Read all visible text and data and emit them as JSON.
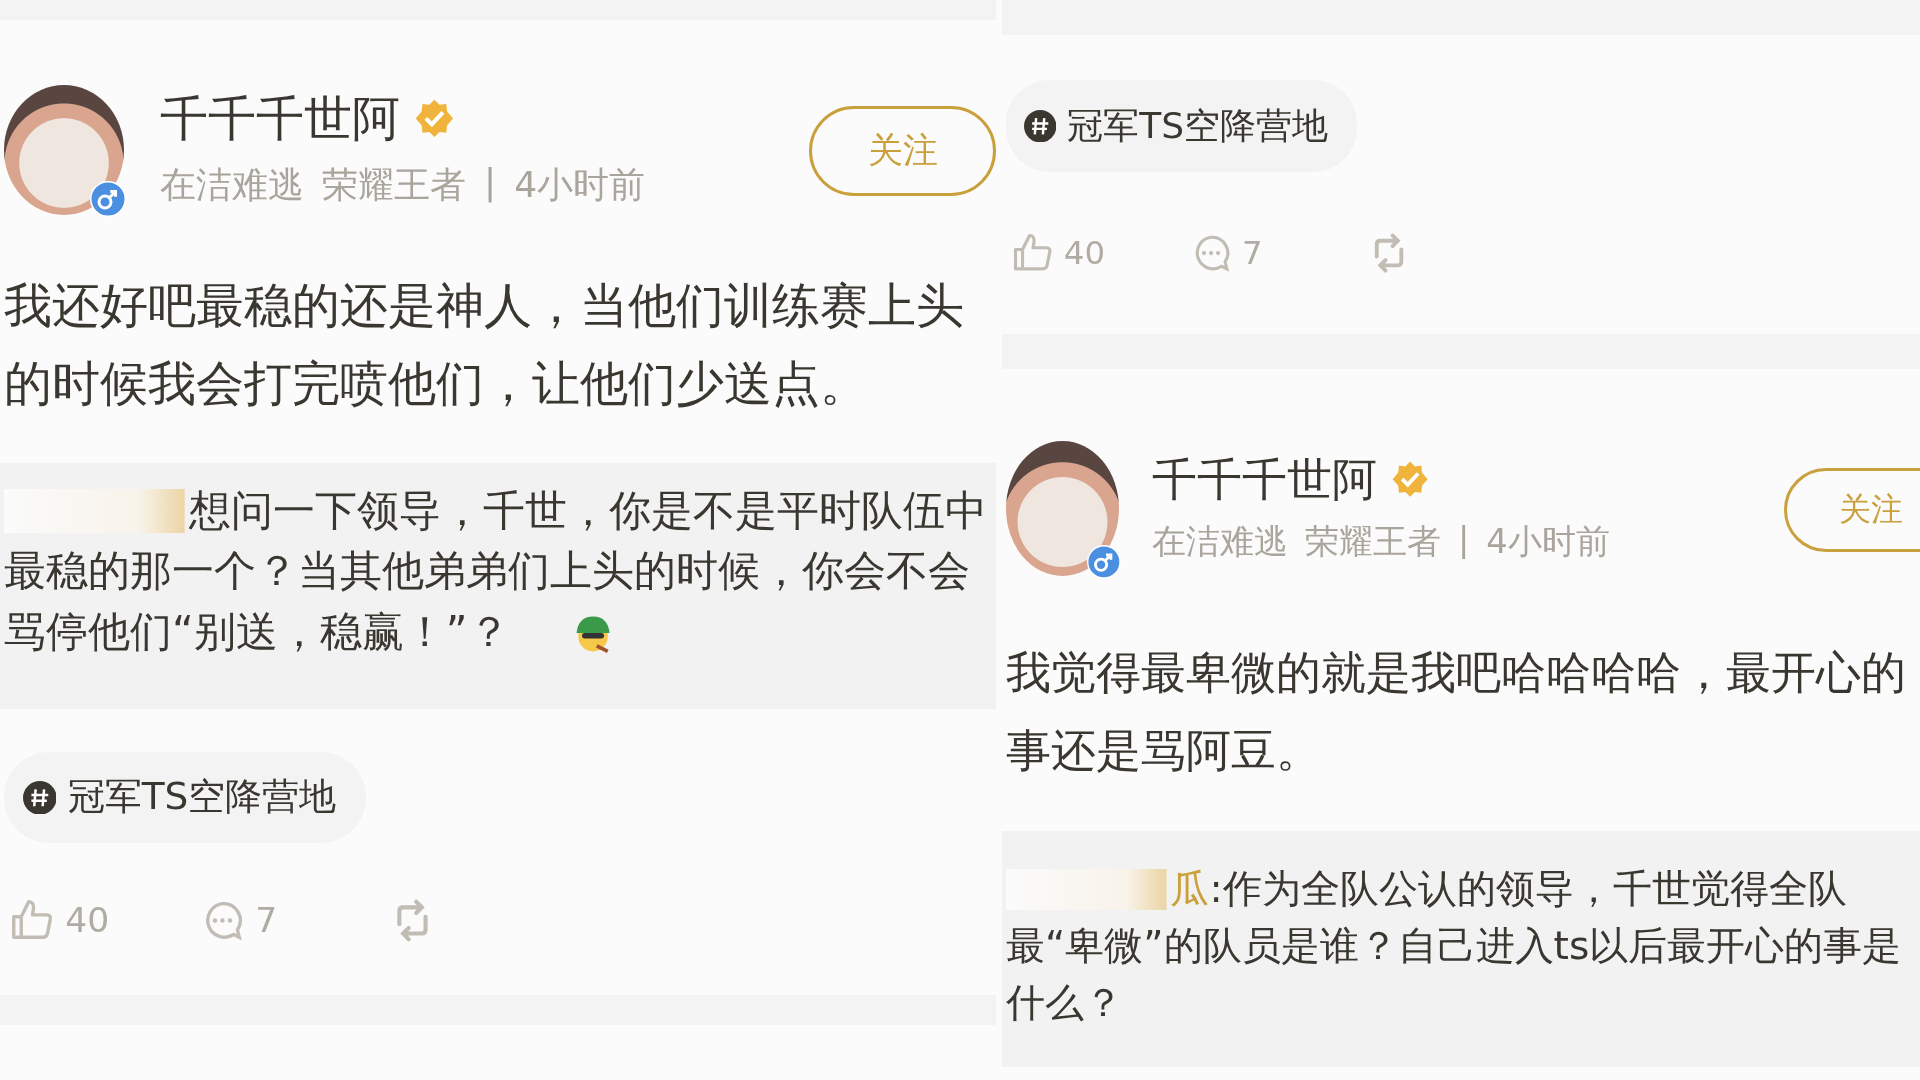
{
  "columns": [
    {
      "blocks": [
        {
          "kind": "gap"
        },
        {
          "kind": "header",
          "name": "千千千世阿",
          "verified": true,
          "game": "在洁难逃",
          "rank": "荣耀王者",
          "separator": "|",
          "time": "4小时前",
          "follow_button": "关注"
        },
        {
          "kind": "body",
          "text": "我还好吧最稳的还是神人，当他们训练赛上头的时候我会打完喷他们，让他们少送点。"
        },
        {
          "kind": "quote",
          "author_blurred": true,
          "text": "想问一下领导，千世，你是不是平时队伍中最稳的那一个？当其他弟弟们上头的时候，你会不会骂停他们“别送，稳赢！”？",
          "trailing_emoji": true
        },
        {
          "kind": "tag",
          "label": "冠军TS空降营地"
        },
        {
          "kind": "actions",
          "likes": "40",
          "comments": "7"
        },
        {
          "kind": "gap"
        }
      ]
    },
    {
      "blocks": [
        {
          "kind": "gap"
        },
        {
          "kind": "tag",
          "label": "冠军TS空降营地"
        },
        {
          "kind": "actions",
          "likes": "40",
          "comments": "7"
        },
        {
          "kind": "gap"
        },
        {
          "kind": "header",
          "name": "千千千世阿",
          "verified": true,
          "game": "在洁难逃",
          "rank": "荣耀王者",
          "separator": "|",
          "time": "4小时前",
          "follow_button": "关注"
        },
        {
          "kind": "body",
          "text": "我觉得最卑微的就是我吧哈哈哈哈，最开心的事还是骂阿豆。"
        },
        {
          "kind": "quote",
          "author_blurred": true,
          "author_visible": "瓜",
          "text": ":作为全队公认的领导，千世觉得全队最“卑微”的队员是谁？自己进入ts以后最开心的事是什么？",
          "trailing_emoji": false
        }
      ]
    }
  ]
}
